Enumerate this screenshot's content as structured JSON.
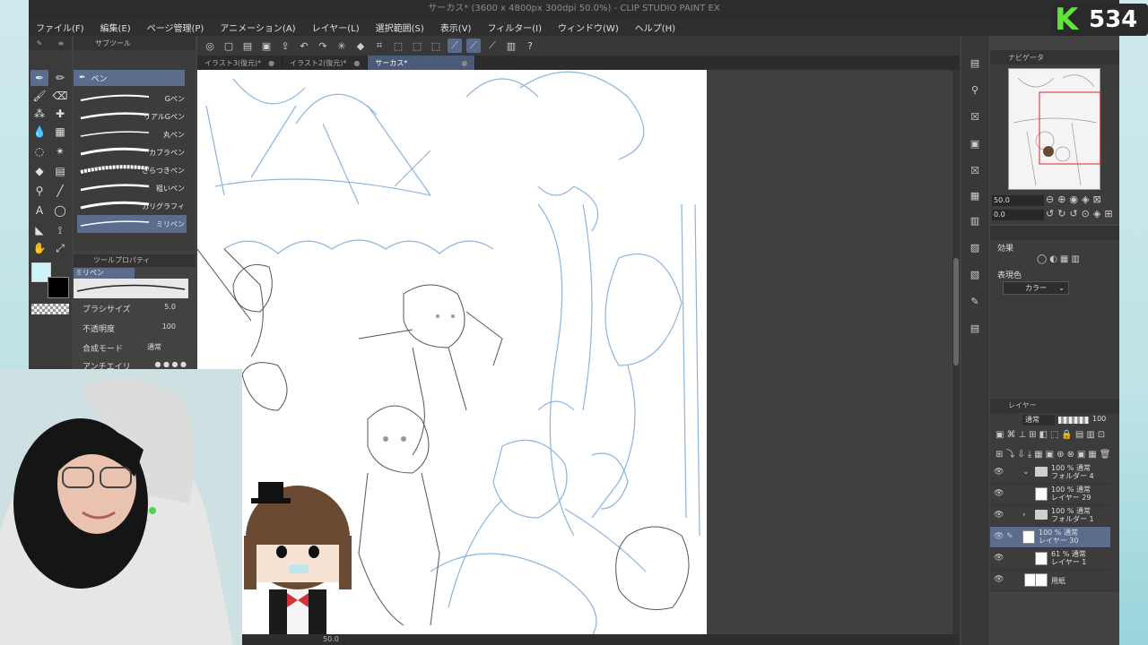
{
  "app": {
    "title": "サーカス* (3600 x 4800px 300dpi 50.0%) - CLIP STUDIO PAINT EX"
  },
  "menu": [
    "ファイル(F)",
    "編集(E)",
    "ページ管理(P)",
    "アニメーション(A)",
    "レイヤー(L)",
    "選択範囲(S)",
    "表示(V)",
    "フィルター(I)",
    "ウィンドウ(W)",
    "ヘルプ(H)"
  ],
  "tabs": [
    {
      "label": "イラスト3(復元)*",
      "active": false
    },
    {
      "label": "イラスト2(復元)*",
      "active": false
    },
    {
      "label": "サーカス*",
      "active": true
    }
  ],
  "subtool": {
    "header": "サブツール",
    "group": "ペン",
    "brushes": [
      "Gペン",
      "リアルGペン",
      "丸ペン",
      "カブラペン",
      "ざらつきペン",
      "粗いペン",
      "カリグラフィ",
      "ミリペン"
    ],
    "selected": "ミリペン"
  },
  "tool_property": {
    "header": "ツールプロパティ",
    "name": "ミリペン",
    "brush_size_label": "ブラシサイズ",
    "brush_size": "5.0",
    "opacity_label": "不透明度",
    "opacity": "100",
    "blend_label": "合成モード",
    "blend": "通常",
    "aa_label": "アンチエイリ"
  },
  "navigator": {
    "header": "ナビゲータ",
    "zoom": "50.0",
    "angle": "0.0"
  },
  "effect": {
    "label": "効果",
    "color_label": "表現色",
    "color_value": "カラー"
  },
  "layers": {
    "header": "レイヤー",
    "blend": "通常",
    "opacity": "100",
    "rows": [
      {
        "l1": "100 % 通常",
        "l2": "フォルダー 4",
        "kind": "folder",
        "open": true
      },
      {
        "l1": "100 % 通常",
        "l2": "レイヤー 29",
        "kind": "layer"
      },
      {
        "l1": "100 % 通常",
        "l2": "フォルダー 1",
        "kind": "folder",
        "open": false
      },
      {
        "l1": "100 % 通常",
        "l2": "レイヤー 30",
        "kind": "layer",
        "selected": true
      },
      {
        "l1": "61 % 通常",
        "l2": "レイヤー 1",
        "kind": "layer"
      },
      {
        "l1": "",
        "l2": "用紙",
        "kind": "paper"
      }
    ]
  },
  "status": {
    "zoom": "50.0"
  },
  "overlay": {
    "badge_letter": "K",
    "badge_number": "534"
  }
}
